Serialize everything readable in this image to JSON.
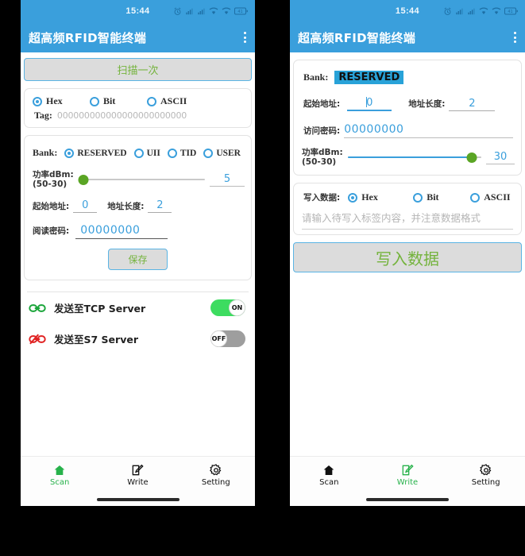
{
  "statusbar": {
    "time": "15:44",
    "battery_level": "41",
    "icons": [
      "alarm-icon",
      "signal-icon",
      "signal-icon",
      "wifi-icon",
      "wifi-icon",
      "battery-icon"
    ]
  },
  "appbar": {
    "title": "超高频RFID智能终端",
    "menu_icon": "kebab-menu-icon"
  },
  "scan_screen": {
    "scan_button": "扫描一次",
    "tag_format": {
      "options": [
        "Hex",
        "Bit",
        "ASCII"
      ],
      "selected": "Hex"
    },
    "tag": {
      "label": "Tag:",
      "value": "000000000000000000000000"
    },
    "bank": {
      "label": "Bank:",
      "options": [
        "RESERVED",
        "UII",
        "TID",
        "USER"
      ],
      "selected": "RESERVED"
    },
    "power": {
      "label_line1": "功率dBm:",
      "label_line2": "(50-30)",
      "value": "5",
      "min": 0,
      "max": 100,
      "percent": 4
    },
    "start_address": {
      "label": "起始地址:",
      "value": "0"
    },
    "address_length": {
      "label": "地址长度:",
      "value": "2"
    },
    "read_password": {
      "label": "阅读密码:",
      "value": "00000000"
    },
    "save_button": "保存",
    "servers": [
      {
        "label": "发送至TCP Server",
        "icon": "link-connected-icon",
        "icon_color": "#1aa53a",
        "state": "ON",
        "on": true
      },
      {
        "label": "发送至S7 Server",
        "icon": "link-broken-icon",
        "icon_color": "#e02222",
        "state": "OFF",
        "on": false
      }
    ]
  },
  "write_screen": {
    "bank": {
      "label": "Bank:",
      "value": "RESERVED"
    },
    "start_address": {
      "label": "起始地址:",
      "value": "0"
    },
    "address_length": {
      "label": "地址长度:",
      "value": "2"
    },
    "access_password": {
      "label": "访问密码:",
      "value": "00000000"
    },
    "power": {
      "label_line1": "功率dBm:",
      "label_line2": "(50-30)",
      "value": "30",
      "percent": 93
    },
    "write_data": {
      "label": "写入数据:",
      "options": [
        "Hex",
        "Bit",
        "ASCII"
      ],
      "selected": "Hex",
      "placeholder": "请输入待写入标签内容，并注意数据格式",
      "value": ""
    },
    "write_button": "写入数据"
  },
  "bottomnav": {
    "items": [
      {
        "label": "Scan",
        "icon": "home-icon"
      },
      {
        "label": "Write",
        "icon": "pencil-square-icon"
      },
      {
        "label": "Setting",
        "icon": "gear-icon"
      }
    ],
    "active_left": "Scan",
    "active_right": "Write"
  },
  "colors": {
    "header_blue": "#3a9fdc",
    "accent_blue": "#3a9fdc",
    "green_text": "#74b33c",
    "nav_active_green": "#27b24b",
    "slider_thumb_green": "#5aa524",
    "toggle_on_green": "#3ddc60",
    "toggle_off_gray": "#9e9e9e",
    "page_background": "#000000"
  }
}
